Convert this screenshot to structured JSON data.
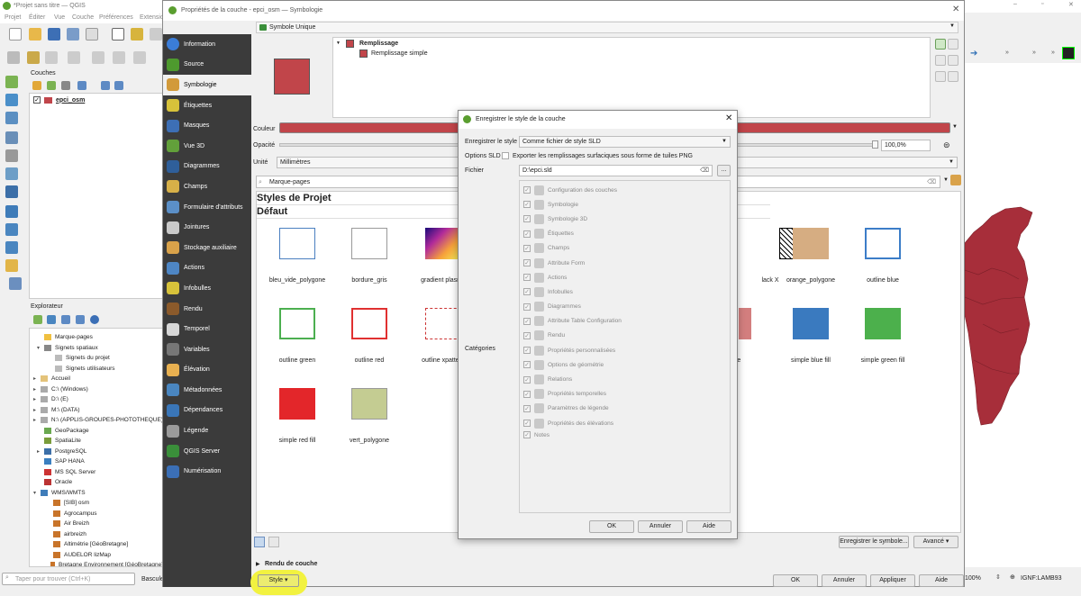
{
  "app": {
    "title": "*Projet sans titre — QGIS",
    "menu": [
      "Projet",
      "Éditer",
      "Vue",
      "Couche",
      "Préférences",
      "Extensio"
    ]
  },
  "layers_panel": {
    "title": "Couches",
    "layer": "epci_osm"
  },
  "explorer": {
    "title": "Explorateur",
    "items": [
      "Marque-pages",
      "Signets spatiaux",
      "Signets du projet",
      "Signets utilisateurs",
      "Accueil",
      "C:\\ (Windows)",
      "D:\\ (E)",
      "M:\\ (DATA)",
      "N:\\ (APPLIS-GROUPES-PHOTOTHEQUE)",
      "GeoPackage",
      "SpatiaLite",
      "PostgreSQL",
      "SAP HANA",
      "MS SQL Server",
      "Oracle",
      "WMS/WMTS",
      "[SIB] osm",
      "Agrocampus",
      "Air Breizh",
      "airbreizh",
      "Altimétrie [GéoBretagne]",
      "AUDELOR lizMap",
      "Bretagne Environnement [GéoBretagne]"
    ]
  },
  "search": {
    "placeholder": "Taper pour trouver (Ctrl+K)",
    "basculer": "Bascule"
  },
  "dialog": {
    "title": "Propriétés de la couche - epci_osm — Symbologie",
    "nav": [
      "Information",
      "Source",
      "Symbologie",
      "Étiquettes",
      "Masques",
      "Vue 3D",
      "Diagrammes",
      "Champs",
      "Formulaire d'attributs",
      "Jointures",
      "Stockage auxiliaire",
      "Actions",
      "Infobulles",
      "Rendu",
      "Temporel",
      "Variables",
      "Élévation",
      "Métadonnées",
      "Dépendances",
      "Légende",
      "QGIS Server",
      "Numérisation"
    ],
    "renderer": "Symbole Unique",
    "tree": {
      "root": "Remplissage",
      "child": "Remplissage simple"
    },
    "couleur_label": "Couleur",
    "opacite_label": "Opacité",
    "opacite_value": "100,0%",
    "unite_label": "Unité",
    "unite_value": "Millimètres",
    "marque_pages": "Marque-pages",
    "styles_title": "Styles de Projet",
    "default_title": "Défaut",
    "symbols": [
      "bleu_vide_polygone",
      "bordure_gris",
      "gradient plasma",
      "lack X",
      "orange_polygone",
      "outline blue",
      "outline green",
      "outline red",
      "outline xpattern",
      "olygone",
      "simple blue fill",
      "simple green fill",
      "simple red fill",
      "vert_polygone"
    ],
    "save_symbol": "Enregistrer le symbole...",
    "avance": "Avancé",
    "rendu_couche": "Rendu de couche",
    "buttons": {
      "style": "Style",
      "ok": "OK",
      "annuler": "Annuler",
      "appliquer": "Appliquer",
      "aide": "Aide"
    },
    "color": "#c1454a"
  },
  "save_dialog": {
    "title": "Enregistrer le style de la couche",
    "style_label": "Enregistrer le style",
    "style_value": "Comme fichier de style SLD",
    "options_label": "Options SLD",
    "options_text": "Exporter les remplissages surfaciques sous forme de tuiles PNG",
    "file_label": "Fichier",
    "file_value": "D:\\epci.sld",
    "browse": "...",
    "categories_label": "Catégories",
    "categories": [
      "Configuration des couches",
      "Symbologie",
      "Symbologie 3D",
      "Étiquettes",
      "Champs",
      "Attribute Form",
      "Actions",
      "Infobulles",
      "Diagrammes",
      "Attribute Table Configuration",
      "Rendu",
      "Propriétés personnalisées",
      "Options de géométrie",
      "Relations",
      "Propriétés temporelles",
      "Paramètres de légende",
      "Propriétés des élévations",
      "Notes"
    ],
    "ok": "OK",
    "annuler": "Annuler",
    "aide": "Aide"
  },
  "statusbar": {
    "zoom": "100%",
    "crs": "IGNF:LAMB93"
  }
}
